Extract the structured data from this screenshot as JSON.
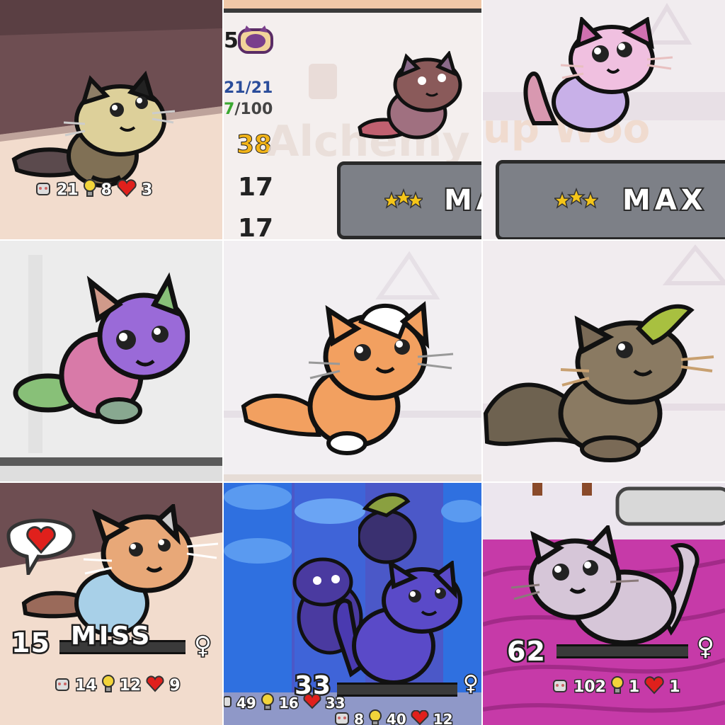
{
  "tile1": {
    "stats": {
      "power": "21",
      "intel": "8",
      "hearts": "3"
    }
  },
  "tile2": {
    "top_number": "5",
    "hp": "21/21",
    "xp_green": "7",
    "xp_total": "/100",
    "val1": "38",
    "val2": "17",
    "val3": "17",
    "button_label": "MA",
    "bg_text": "Alchemy"
  },
  "tile3": {
    "button_label": "MAX",
    "bg_text": "up Woo"
  },
  "tile7": {
    "level": "15",
    "miss_text": "MISS",
    "gender": "♀",
    "stats": {
      "power": "14",
      "intel": "12",
      "hearts": "9"
    }
  },
  "tile8": {
    "level": "33",
    "gender": "♀",
    "back_stats": {
      "power": "49",
      "intel": "16",
      "hearts": "33"
    },
    "stats": {
      "power": "8",
      "intel": "40",
      "hearts": "12"
    }
  },
  "tile9": {
    "level": "62",
    "gender": "♀",
    "stats": {
      "power": "102",
      "intel": "1",
      "hearts": "1"
    }
  },
  "colors": {
    "heart": "#e0201c",
    "star": "#f5c518",
    "bulb": "#f2d43a",
    "outline": "#1e1e1e"
  }
}
